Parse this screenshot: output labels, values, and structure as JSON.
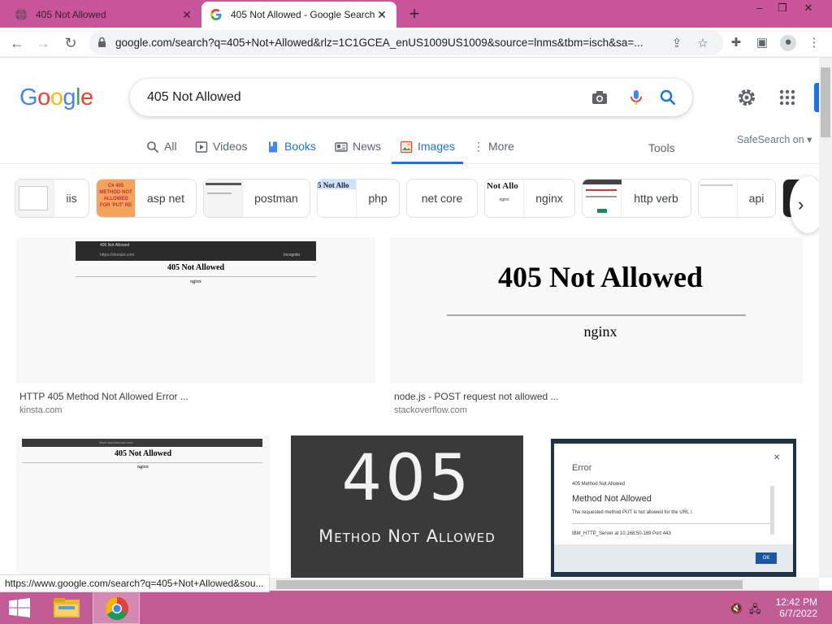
{
  "browser": {
    "tabs": [
      {
        "title": "405 Not Allowed",
        "active": false
      },
      {
        "title": "405 Not Allowed - Google Search",
        "active": true
      }
    ],
    "new_tab_label": "+",
    "window": {
      "minimize": "–",
      "maximize": "❐",
      "close": "✕"
    },
    "url": "google.com/search?q=405+Not+Allowed&rlz=1C1GCEA_enUS1009US1009&source=lnms&tbm=isch&sa=...",
    "status_url": "https://www.google.com/search?q=405+Not+Allowed&sou..."
  },
  "google": {
    "logo_letters": [
      {
        "ch": "G",
        "color": "#4285F4"
      },
      {
        "ch": "o",
        "color": "#EA4335"
      },
      {
        "ch": "o",
        "color": "#FBBC05"
      },
      {
        "ch": "g",
        "color": "#4285F4"
      },
      {
        "ch": "l",
        "color": "#34A853"
      },
      {
        "ch": "e",
        "color": "#EA4335"
      }
    ],
    "query": "405 Not Allowed",
    "nav_tabs": {
      "all": "All",
      "videos": "Videos",
      "books": "Books",
      "news": "News",
      "images": "Images",
      "more": "More"
    },
    "tools": "Tools",
    "safesearch": "SafeSearch on ▾",
    "chips": [
      "iis",
      "asp net",
      "postman",
      "php",
      "net core",
      "nginx",
      "http verb",
      "api"
    ]
  },
  "results": [
    {
      "caption": "HTTP 405 Method Not Allowed Error ...",
      "source": "kinsta.com",
      "img_title": "405 Not Allowed",
      "img_sub": "nginx",
      "browser_tab": "405 Not Allowed",
      "browser_url": "https://domain.com",
      "browser_badge": "Incognito"
    },
    {
      "caption": "node.js - POST request not allowed ...",
      "source": "stackoverflow.com",
      "img_title": "405 Not Allowed",
      "img_sub": "nginx"
    },
    {
      "img_title": "405 Not Allowed",
      "img_sub": "nginx",
      "browser_url": "https://yourdomain.com"
    },
    {
      "img_big": "405",
      "img_sub": "Method Not Allowed"
    },
    {
      "dialog_title": "Error",
      "dialog_line1": "405 Method Not Allowed",
      "dialog_heading": "Method Not Allowed",
      "dialog_line2": "The requested method PUT is not allowed for the URL /.",
      "dialog_line3": "IBM_HTTP_Server at 10.168.50.169 Port 443",
      "dialog_ok": "OK",
      "dialog_close": "✕"
    }
  ],
  "chip_thumbs": {
    "asp": "C# 405 METHOD NOT ALLOWED FOR 'PUT' RE",
    "php": "5 Not Allo",
    "nginx": "Not Allo",
    "nginx_sub": "nginx"
  },
  "taskbar": {
    "time": "12:42 PM",
    "date": "6/7/2022"
  },
  "colors": {
    "accent": "#1a73e8",
    "tabstrip": "#c8549a",
    "taskbar": "#c25c96"
  }
}
